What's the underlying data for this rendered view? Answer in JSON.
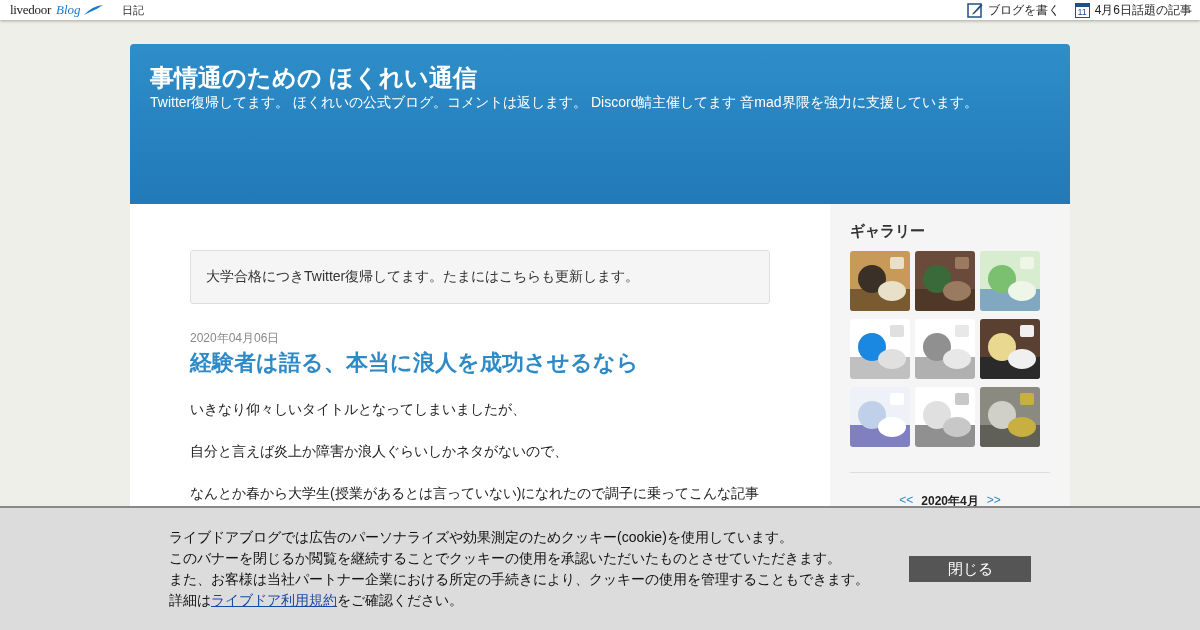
{
  "top_bar": {
    "logo": {
      "word": "livedoor",
      "script": "Blog"
    },
    "links": [
      {
        "label": "日記"
      }
    ],
    "actions": [
      {
        "kind": "write",
        "label": "ブログを書く"
      },
      {
        "kind": "calendar",
        "label": "4月6日話題の記事",
        "icon_text": "11"
      }
    ]
  },
  "header": {
    "title": "事情通のための ほくれい通信",
    "description": "Twitter復帰してます。 ほくれいの公式ブログ。コメントは返します。 Discord鯖主催してます 音mad界隈を強力に支援しています。"
  },
  "notice": "大学合格につきTwitter復帰してます。たまにはこちらも更新します。",
  "article": {
    "date": "2020年04月06日",
    "title": "経験者は語る、本当に浪人を成功させるなら",
    "paragraphs": [
      "いきなり仰々しいタイトルとなってしまいましたが、",
      "自分と言えば炎上か障害か浪人ぐらいしかネタがないので、",
      "なんとか春から大学生(授業があるとは言っていない)になれたので調子に乗ってこんな記事"
    ]
  },
  "sidebar": {
    "gallery": {
      "title": "ギャラリー"
    },
    "calendar": {
      "prev": "<<",
      "month": "2020年4月",
      "next": ">>"
    }
  },
  "cookie_banner": {
    "lines": [
      "ライブドアブログでは広告のパーソナライズや効果測定のためクッキー(cookie)を使用しています。",
      "このバナーを閉じるか閲覧を継続することでクッキーの使用を承認いただいたものとさせていただきます。",
      "また、お客様は当社パートナー企業における所定の手続きにより、クッキーの使用を管理することもできます。"
    ],
    "last_line": {
      "before": "詳細は",
      "link": "ライブドア利用規約",
      "after": "をご確認ください。"
    },
    "button": "閉じる"
  }
}
